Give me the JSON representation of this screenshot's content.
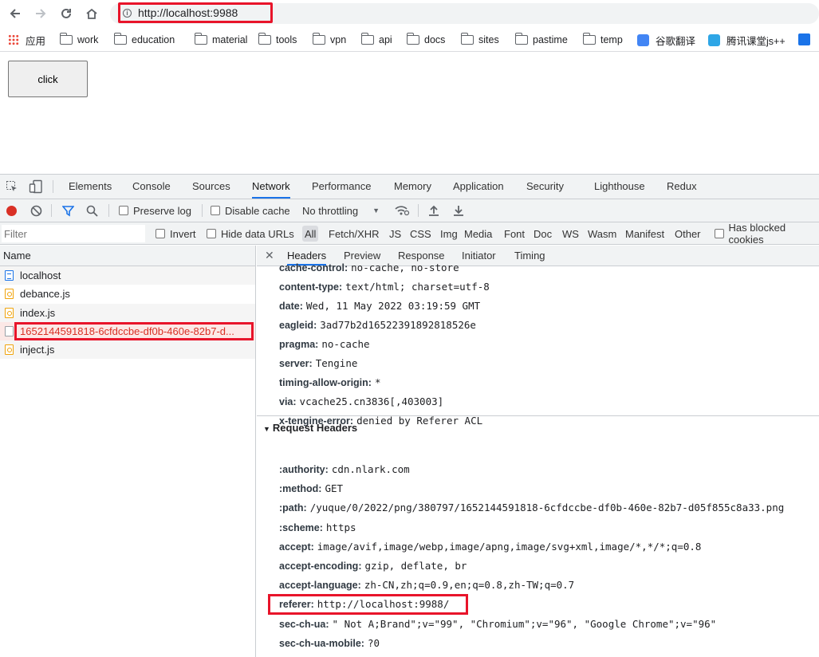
{
  "browser": {
    "url": "http://localhost:9988",
    "bookmarks": [
      {
        "icon": "apps-icon",
        "label": "应用"
      },
      {
        "icon": "folder-icon",
        "label": "work"
      },
      {
        "icon": "folder-icon",
        "label": "education"
      },
      {
        "icon": "folder-icon",
        "label": "material"
      },
      {
        "icon": "folder-icon",
        "label": "tools"
      },
      {
        "icon": "folder-icon",
        "label": "vpn"
      },
      {
        "icon": "folder-icon",
        "label": "api"
      },
      {
        "icon": "folder-icon",
        "label": "docs"
      },
      {
        "icon": "folder-icon",
        "label": "sites"
      },
      {
        "icon": "folder-icon",
        "label": "pastime"
      },
      {
        "icon": "folder-icon",
        "label": "temp"
      },
      {
        "icon": "google-translate-icon",
        "label": "谷歌翻译"
      },
      {
        "icon": "tencent-class-icon",
        "label": "腾讯课堂js++"
      }
    ]
  },
  "page": {
    "button_label": "click"
  },
  "devtools": {
    "tabs": [
      "Elements",
      "Console",
      "Sources",
      "Network",
      "Performance",
      "Memory",
      "Application",
      "Security",
      "Lighthouse",
      "Redux"
    ],
    "active_tab": "Network",
    "toolbar": {
      "preserve_log": "Preserve log",
      "disable_cache": "Disable cache",
      "throttling": "No throttling"
    },
    "filter": {
      "placeholder": "Filter",
      "invert": "Invert",
      "hide_data_urls": "Hide data URLs",
      "types": [
        "All",
        "Fetch/XHR",
        "JS",
        "CSS",
        "Img",
        "Media",
        "Font",
        "Doc",
        "WS",
        "Wasm",
        "Manifest",
        "Other"
      ],
      "has_blocked": "Has blocked cookies"
    },
    "list_header": "Name",
    "requests": [
      {
        "name": "localhost",
        "type": "doc"
      },
      {
        "name": "debance.js",
        "type": "js"
      },
      {
        "name": "index.js",
        "type": "js"
      },
      {
        "name": "1652144591818-6cfdccbe-df0b-460e-82b7-d...",
        "type": "img"
      },
      {
        "name": "inject.js",
        "type": "js"
      }
    ],
    "detail_tabs": [
      "Headers",
      "Preview",
      "Response",
      "Initiator",
      "Timing"
    ],
    "response_headers": [
      {
        "k": "cache-control:",
        "v": "no-cache, no-store"
      },
      {
        "k": "content-type:",
        "v": "text/html; charset=utf-8"
      },
      {
        "k": "date:",
        "v": "Wed, 11 May 2022 03:19:59 GMT"
      },
      {
        "k": "eagleid:",
        "v": "3ad77b2d16522391892818526e"
      },
      {
        "k": "pragma:",
        "v": "no-cache"
      },
      {
        "k": "server:",
        "v": "Tengine"
      },
      {
        "k": "timing-allow-origin:",
        "v": "*"
      },
      {
        "k": "via:",
        "v": "vcache25.cn3836[,403003]"
      },
      {
        "k": "x-tengine-error:",
        "v": "denied by Referer ACL"
      }
    ],
    "request_headers_title": "Request Headers",
    "request_headers": [
      {
        "k": ":authority:",
        "v": "cdn.nlark.com"
      },
      {
        "k": ":method:",
        "v": "GET"
      },
      {
        "k": ":path:",
        "v": "/yuque/0/2022/png/380797/1652144591818-6cfdccbe-df0b-460e-82b7-d05f855c8a33.png"
      },
      {
        "k": ":scheme:",
        "v": "https"
      },
      {
        "k": "accept:",
        "v": "image/avif,image/webp,image/apng,image/svg+xml,image/*,*/*;q=0.8"
      },
      {
        "k": "accept-encoding:",
        "v": "gzip, deflate, br"
      },
      {
        "k": "accept-language:",
        "v": "zh-CN,zh;q=0.9,en;q=0.8,zh-TW;q=0.7"
      },
      {
        "k": "referer:",
        "v": "http://localhost:9988/"
      },
      {
        "k": "sec-ch-ua:",
        "v": "\" Not A;Brand\";v=\"99\", \"Chromium\";v=\"96\", \"Google Chrome\";v=\"96\""
      },
      {
        "k": "sec-ch-ua-mobile:",
        "v": "?0"
      }
    ]
  },
  "colors": {
    "highlight": "#e8142a",
    "accent": "#1a73e8",
    "record": "#d93025"
  }
}
